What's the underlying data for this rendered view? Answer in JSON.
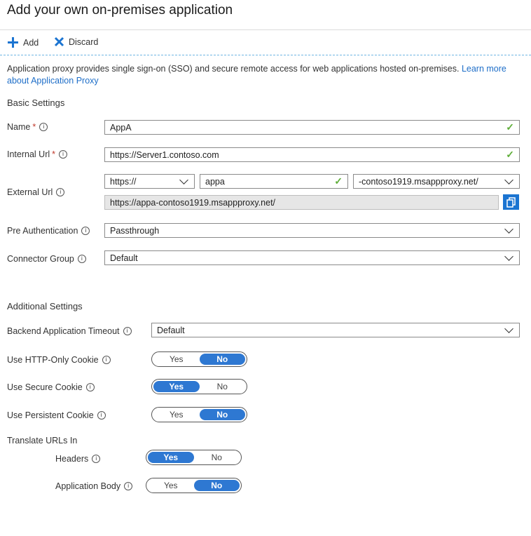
{
  "page": {
    "title": "Add your own on-premises application"
  },
  "toolbar": {
    "add_label": "Add",
    "discard_label": "Discard"
  },
  "description": {
    "text": "Application proxy provides single sign-on (SSO) and secure remote access for web applications hosted on-premises. ",
    "link": "Learn more about Application Proxy"
  },
  "basic": {
    "heading": "Basic Settings",
    "name": {
      "label": "Name",
      "value": "AppA"
    },
    "internal_url": {
      "label": "Internal Url",
      "value": "https://Server1.contoso.com"
    },
    "external_url": {
      "label": "External Url",
      "scheme": "https://",
      "prefix": "appa",
      "domain": "-contoso1919.msappproxy.net/",
      "full": "https://appa-contoso1919.msappproxy.net/"
    },
    "pre_auth": {
      "label": "Pre Authentication",
      "value": "Passthrough"
    },
    "connector_group": {
      "label": "Connector Group",
      "value": "Default"
    }
  },
  "additional": {
    "heading": "Additional Settings",
    "backend_timeout": {
      "label": "Backend Application Timeout",
      "value": "Default"
    },
    "http_only_cookie": {
      "label": "Use HTTP-Only Cookie",
      "yes": "Yes",
      "no": "No",
      "selected": "No"
    },
    "secure_cookie": {
      "label": "Use Secure Cookie",
      "yes": "Yes",
      "no": "No",
      "selected": "Yes"
    },
    "persistent_cookie": {
      "label": "Use Persistent Cookie",
      "yes": "Yes",
      "no": "No",
      "selected": "No"
    },
    "translate_urls": {
      "heading": "Translate URLs In",
      "headers": {
        "label": "Headers",
        "yes": "Yes",
        "no": "No",
        "selected": "Yes"
      },
      "body": {
        "label": "Application Body",
        "yes": "Yes",
        "no": "No",
        "selected": "No"
      }
    }
  },
  "colors": {
    "accent": "#2e78d2",
    "valid_check": "#5fae39",
    "required": "#c0392b",
    "link": "#1e6ec8"
  }
}
